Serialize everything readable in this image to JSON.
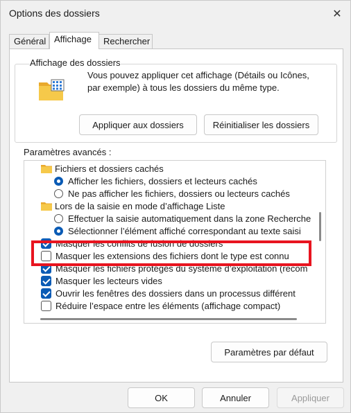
{
  "window": {
    "title": "Options des dossiers",
    "close_icon": "close-icon"
  },
  "tabs": [
    {
      "label": "Général",
      "active": false
    },
    {
      "label": "Affichage",
      "active": true
    },
    {
      "label": "Rechercher",
      "active": false
    }
  ],
  "folder_view": {
    "group_title": "Affichage des dossiers",
    "description": "Vous pouvez appliquer cet affichage (Détails ou Icônes, par exemple) à tous les dossiers du même type.",
    "apply_button": "Appliquer aux dossiers",
    "reset_button": "Réinitialiser les dossiers"
  },
  "advanced": {
    "label": "Paramètres avancés :",
    "items": [
      {
        "kind": "folder",
        "text": "Fichiers et dossiers cachés"
      },
      {
        "kind": "radio",
        "checked": true,
        "text": "Afficher les fichiers, dossiers et lecteurs cachés"
      },
      {
        "kind": "radio",
        "checked": false,
        "text": "Ne pas afficher les fichiers, dossiers ou lecteurs cachés"
      },
      {
        "kind": "folder",
        "text": "Lors de la saisie en mode d’affichage Liste"
      },
      {
        "kind": "radio",
        "checked": false,
        "text": "Effectuer la saisie automatiquement dans la zone Recherche"
      },
      {
        "kind": "radio",
        "checked": true,
        "text": "Sélectionner l’élément affiché correspondant au texte saisi"
      },
      {
        "kind": "checkbox",
        "checked": true,
        "text": "Masquer les conflits de fusion de dossiers"
      },
      {
        "kind": "checkbox",
        "checked": false,
        "text": "Masquer les extensions des fichiers dont le type est connu"
      },
      {
        "kind": "checkbox",
        "checked": true,
        "text": "Masquer les fichiers protégés du système d’exploitation (recom"
      },
      {
        "kind": "checkbox",
        "checked": true,
        "text": "Masquer les lecteurs vides"
      },
      {
        "kind": "checkbox",
        "checked": true,
        "text": "Ouvrir les fenêtres des dossiers dans un processus différent"
      },
      {
        "kind": "checkbox",
        "checked": false,
        "text": "Réduire l’espace entre les éléments (affichage compact)"
      }
    ],
    "defaults_button": "Paramètres par défaut"
  },
  "footer": {
    "ok": "OK",
    "cancel": "Annuler",
    "apply": "Appliquer"
  },
  "colors": {
    "accent": "#0a5bb5",
    "highlight_border": "#e8141f",
    "folder": "#f3c13a"
  }
}
